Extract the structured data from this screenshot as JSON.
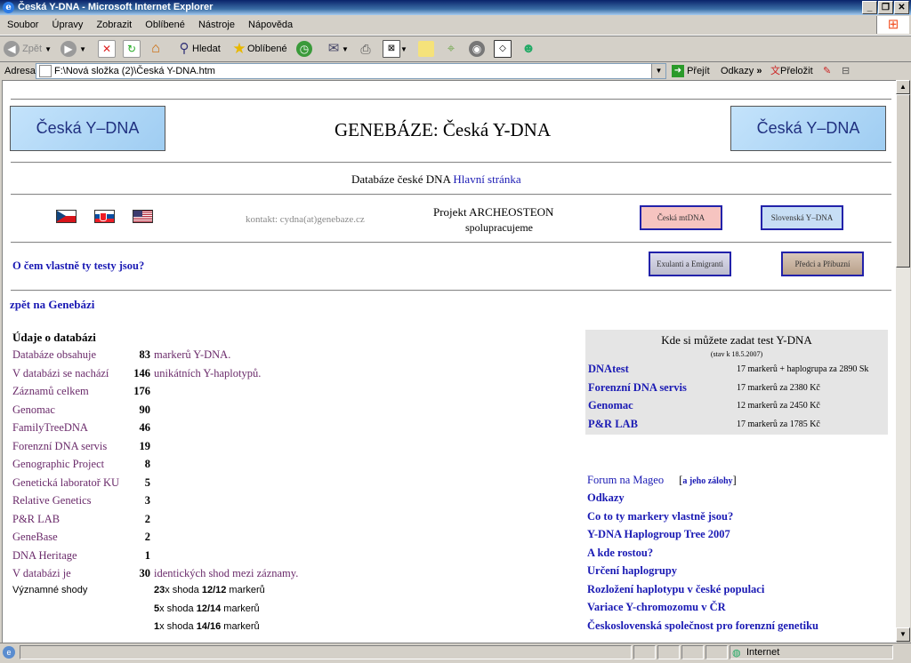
{
  "window": {
    "title": "Česká Y-DNA - Microsoft Internet Explorer"
  },
  "menu": [
    "Soubor",
    "Úpravy",
    "Zobrazit",
    "Oblíbené",
    "Nástroje",
    "Nápověda"
  ],
  "toolbar": {
    "back": "Zpět",
    "search": "Hledat",
    "favorites": "Oblíbené"
  },
  "address": {
    "label": "Adresa",
    "value": "F:\\Nová složka (2)\\Česká Y-DNA.htm",
    "go": "Přejít",
    "links": "Odkazy",
    "translate": "Přeložit"
  },
  "page": {
    "banner_text": "Česká Y–DNA",
    "main_title": "GENEBÁZE: Česká Y-DNA",
    "subtitle_prefix": "Databáze české DNA",
    "subtitle_link": "Hlavní stránka",
    "contact": "kontakt: cydna(at)genebaze.cz",
    "project_line1": "Projekt ARCHEOSTEON",
    "project_line2": "spolupracujeme",
    "btn_mtdna": "Česká mtDNA",
    "btn_slovak": "Slovenská Y–DNA",
    "btn_exulanti": "Exulanti a Emigranti",
    "btn_predci": "Předci a Příbuzní",
    "tests_link": "O čem vlastně ty testy jsou?",
    "back_link": "zpět na Genebázi",
    "db_header": "Údaje o databázi",
    "db_rows": [
      {
        "label": "Databáze obsahuje",
        "value": "83",
        "suffix": "markerů Y-DNA."
      },
      {
        "label": "V databázi se nachází",
        "value": "146",
        "suffix": "unikátních Y-haplotypů."
      },
      {
        "label": "Záznamů celkem",
        "value": "176",
        "suffix": ""
      },
      {
        "label": "Genomac",
        "value": "90",
        "suffix": ""
      },
      {
        "label": "FamilyTreeDNA",
        "value": "46",
        "suffix": ""
      },
      {
        "label": "Forenzní DNA servis",
        "value": "19",
        "suffix": ""
      },
      {
        "label": "Genographic Project",
        "value": "8",
        "suffix": ""
      },
      {
        "label": "Genetická laboratoř KU",
        "value": "5",
        "suffix": ""
      },
      {
        "label": "Relative Genetics",
        "value": "3",
        "suffix": ""
      },
      {
        "label": "P&R LAB",
        "value": "2",
        "suffix": ""
      },
      {
        "label": "GeneBase",
        "value": "2",
        "suffix": ""
      },
      {
        "label": "DNA Heritage",
        "value": "1",
        "suffix": ""
      },
      {
        "label": "V databázi je",
        "value": "30",
        "suffix": "identických shod mezi záznamy."
      }
    ],
    "matches_label": "Významné shody",
    "matches": [
      {
        "count": "23",
        "x": "x shoda ",
        "range": "12/12",
        "unit": " markerů"
      },
      {
        "count": "5",
        "x": "x shoda ",
        "range": "12/14",
        "unit": " markerů"
      },
      {
        "count": "1",
        "x": "x shoda ",
        "range": "14/16",
        "unit": " markerů"
      }
    ],
    "test_box": {
      "title": "Kde si můžete zadat test Y-DNA",
      "date": "(stav k 18.5.2007)",
      "rows": [
        {
          "name": "DNAtest",
          "desc": "17 markerů + haplogrupa za 2890 Sk"
        },
        {
          "name": "Forenzní DNA servis",
          "desc": "17 markerů za 2380 Kč"
        },
        {
          "name": "Genomac",
          "desc": "12 markerů za 2450 Kč"
        },
        {
          "name": "P&R LAB",
          "desc": "17 markerů za 1785 Kč"
        }
      ]
    },
    "forum": "Forum na Mageo",
    "forum_backup": "a jeho zálohy",
    "right_links": [
      "Odkazy",
      "Co to ty markery vlastně jsou?",
      "Y-DNA Haplogroup Tree 2007",
      "A kde rostou?",
      "Určení haplogrupy",
      "Rozložení haplotypu v české populaci",
      "Variace Y-chromozomu v ČR",
      "Československá společnost pro forenzní genetiku"
    ]
  },
  "status": {
    "zone": "Internet"
  }
}
